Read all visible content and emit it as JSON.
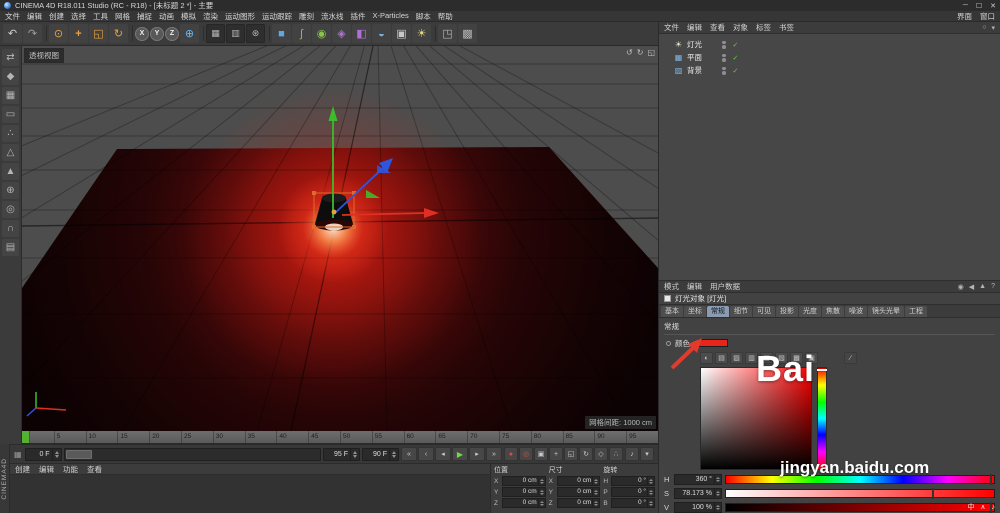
{
  "icons": {
    "check": "✓",
    "film": "▦",
    "eyedropper": "∕"
  },
  "titlebar": {
    "title": "CINEMA 4D R18.011 Studio (RC - R18) - [未标题 2 *] - 主要",
    "minimize": "─",
    "maximize": "☐",
    "close": "✕"
  },
  "menubar": {
    "items": [
      "文件",
      "编辑",
      "创建",
      "选择",
      "工具",
      "网格",
      "捕捉",
      "动画",
      "模拟",
      "渲染",
      "运动图形",
      "运动跟踪",
      "雕刻",
      "流水线",
      "插件",
      "X-Particles",
      "脚本",
      "帮助"
    ],
    "right_items": [
      "界面",
      "窗口"
    ]
  },
  "toolbar": {
    "icons": [
      {
        "name": "undo-icon",
        "glyph": "↶",
        "color": "#cfcfcf"
      },
      {
        "name": "redo-icon",
        "glyph": "↷",
        "color": "#9f9f9f"
      },
      {
        "name": "toolbar-separator",
        "cls": "sep",
        "glyph": "",
        "inter": false
      },
      {
        "name": "live-selection-icon",
        "glyph": "⊙",
        "color": "#e8a33d"
      },
      {
        "name": "move-tool-icon",
        "glyph": "+",
        "color": "#e8a33d",
        "cls": "bold"
      },
      {
        "name": "scale-tool-icon",
        "glyph": "◱",
        "color": "#e8a33d"
      },
      {
        "name": "rotate-tool-icon",
        "glyph": "↻",
        "color": "#e8a33d"
      },
      {
        "name": "toolbar-separator",
        "cls": "sep",
        "glyph": "",
        "inter": false
      },
      {
        "name": "x-axis-lock-button",
        "glyph": "X",
        "cls": "axis"
      },
      {
        "name": "y-axis-lock-button",
        "glyph": "Y",
        "cls": "axis"
      },
      {
        "name": "z-axis-lock-button",
        "glyph": "Z",
        "cls": "axis"
      },
      {
        "name": "coordinate-system-icon",
        "glyph": "⊕",
        "color": "#6fb3e8"
      },
      {
        "name": "toolbar-separator",
        "cls": "sep",
        "glyph": "",
        "inter": false
      },
      {
        "name": "render-view-icon",
        "glyph": "▦",
        "cls": "dark",
        "color": "#b5b5b5"
      },
      {
        "name": "render-picture-viewer-icon",
        "glyph": "▥",
        "cls": "dark",
        "color": "#b5b5b5"
      },
      {
        "name": "render-settings-icon",
        "glyph": "⊛",
        "cls": "dark",
        "color": "#b5b5b5"
      },
      {
        "name": "toolbar-separator",
        "cls": "sep",
        "glyph": "",
        "inter": false
      },
      {
        "name": "add-primitive-icon",
        "glyph": "■",
        "color": "#5fa8e0"
      },
      {
        "name": "add-spline-icon",
        "glyph": "∫",
        "color": "#8ac34a"
      },
      {
        "name": "add-generator-icon",
        "glyph": "◉",
        "color": "#8ac34a"
      },
      {
        "name": "add-mograph-icon",
        "glyph": "◈",
        "color": "#b06fd8"
      },
      {
        "name": "add-deformer-icon",
        "glyph": "◧",
        "color": "#b06fd8"
      },
      {
        "name": "add-environment-icon",
        "glyph": "◒",
        "color": "#6fb3e8"
      },
      {
        "name": "add-camera-icon",
        "glyph": "▣",
        "color": "#c8c8c8"
      },
      {
        "name": "add-light-icon",
        "glyph": "☀",
        "color": "#e8d87a"
      },
      {
        "name": "toolbar-separator",
        "cls": "sep",
        "glyph": "",
        "inter": false
      },
      {
        "name": "display-mode-icon",
        "glyph": "◳",
        "color": "#b5b5b5"
      },
      {
        "name": "view-panel-icon",
        "glyph": "▩",
        "color": "#b5b5b5"
      }
    ]
  },
  "left_toolbar": {
    "brand": "CINEMA4D",
    "icons": [
      {
        "name": "make-editable-icon",
        "glyph": "⇄"
      },
      {
        "name": "model-mode-icon",
        "glyph": "◆"
      },
      {
        "name": "texture-mode-icon",
        "glyph": "▦"
      },
      {
        "name": "workplane-mode-icon",
        "glyph": "▭"
      },
      {
        "name": "points-mode-icon",
        "glyph": "∴"
      },
      {
        "name": "edges-mode-icon",
        "glyph": "△"
      },
      {
        "name": "polygons-mode-icon",
        "glyph": "▲"
      },
      {
        "name": "enable-axis-icon",
        "glyph": "⊕"
      },
      {
        "name": "viewport-solo-icon",
        "glyph": "◎"
      },
      {
        "name": "snap-icon",
        "glyph": "∩"
      },
      {
        "name": "workplane-lock-icon",
        "glyph": "▤"
      }
    ]
  },
  "viewport": {
    "label": "透视视图",
    "grid_info": "网格间距: 1000 cm",
    "corner_icons": [
      {
        "name": "undo-view-icon",
        "glyph": "↺"
      },
      {
        "name": "redo-view-icon",
        "glyph": "↻"
      },
      {
        "name": "toggle-views-icon",
        "glyph": "◱"
      }
    ]
  },
  "ruler": {
    "ticks": [
      "0",
      "5",
      "10",
      "15",
      "20",
      "25",
      "30",
      "35",
      "40",
      "45",
      "50",
      "55",
      "60",
      "65",
      "70",
      "75",
      "80",
      "85",
      "90",
      "95"
    ]
  },
  "transport": {
    "current": "0 F",
    "end": "95 F",
    "loop": "90 F",
    "buttons": [
      {
        "name": "goto-start-button",
        "glyph": "«"
      },
      {
        "name": "prev-key-button",
        "glyph": "‹"
      },
      {
        "name": "prev-frame-button",
        "glyph": "◂"
      },
      {
        "name": "play-button",
        "glyph": "▶",
        "cls": "play"
      },
      {
        "name": "next-frame-button",
        "glyph": "▸"
      },
      {
        "name": "goto-end-button",
        "glyph": "»"
      }
    ],
    "record_buttons": [
      {
        "name": "record-keyframe-button",
        "glyph": "●",
        "cls": "red"
      },
      {
        "name": "autokey-button",
        "glyph": "◎",
        "cls": "red"
      },
      {
        "name": "keyframe-selection-button",
        "glyph": "▣"
      },
      {
        "name": "record-position-button",
        "glyph": "+"
      },
      {
        "name": "record-scale-button",
        "glyph": "◱"
      },
      {
        "name": "record-rotation-button",
        "glyph": "↻"
      },
      {
        "name": "record-parameter-button",
        "glyph": "◇"
      },
      {
        "name": "record-pla-button",
        "glyph": "∴"
      }
    ],
    "end_buttons": [
      {
        "name": "sound-toggle-button",
        "glyph": "♪"
      },
      {
        "name": "playback-options-button",
        "glyph": "▾"
      }
    ]
  },
  "material_manager": {
    "menus": [
      "创建",
      "编辑",
      "功能",
      "查看"
    ]
  },
  "coordinates": {
    "groups": [
      {
        "title": "位置",
        "rows": [
          {
            "label": "X",
            "value": "0 cm"
          },
          {
            "label": "Y",
            "value": "0 cm"
          },
          {
            "label": "Z",
            "value": "0 cm"
          }
        ]
      },
      {
        "title": "尺寸",
        "rows": [
          {
            "label": "X",
            "value": "0 cm"
          },
          {
            "label": "Y",
            "value": "0 cm"
          },
          {
            "label": "Z",
            "value": "0 cm"
          }
        ]
      },
      {
        "title": "旋转",
        "rows": [
          {
            "label": "H",
            "value": "0 °"
          },
          {
            "label": "P",
            "value": "0 °"
          },
          {
            "label": "B",
            "value": "0 °"
          }
        ]
      }
    ]
  },
  "object_manager": {
    "menus": [
      "文件",
      "编辑",
      "查看",
      "对象",
      "标签",
      "书签"
    ],
    "right_icons": [
      {
        "name": "om-search-icon",
        "glyph": "○"
      },
      {
        "name": "om-filter-icon",
        "glyph": "▾"
      }
    ],
    "objects": [
      {
        "label": "灯光",
        "glyph": "☀",
        "icon_style": "color:#f2ecd8"
      },
      {
        "label": "平面",
        "glyph": "▦",
        "icon_style": "color:#7db7e8"
      },
      {
        "label": "背景",
        "glyph": "▨",
        "icon_style": "color:#7db7e8"
      }
    ]
  },
  "attribute_manager": {
    "menus": [
      "模式",
      "编辑",
      "用户数据"
    ],
    "right_icons": [
      {
        "name": "am-lock-icon",
        "glyph": "◉"
      },
      {
        "name": "am-back-icon",
        "glyph": "◀"
      },
      {
        "name": "am-forward-icon",
        "glyph": "▲"
      },
      {
        "name": "am-help-icon",
        "glyph": "?"
      }
    ],
    "object_title": "灯光对象 [灯光]",
    "tabs": [
      {
        "label": "基本"
      },
      {
        "label": "坐标"
      },
      {
        "label": "常规",
        "cls": "active"
      },
      {
        "label": "细节"
      },
      {
        "label": "可见"
      },
      {
        "label": "投影"
      },
      {
        "label": "光度"
      },
      {
        "label": "焦散"
      },
      {
        "label": "噪波"
      },
      {
        "label": "镜头光晕"
      },
      {
        "label": "工程"
      }
    ],
    "section": "常规",
    "color_label": "颜色",
    "swatch_style": "background:#e8251a",
    "picker_icons": [
      {
        "name": "color-wheel-icon",
        "glyph": "◐"
      },
      {
        "name": "color-spectrum-icon",
        "glyph": "▤"
      },
      {
        "name": "color-from-image-icon",
        "glyph": "▨"
      },
      {
        "name": "color-rgb-icon",
        "glyph": "▥"
      },
      {
        "name": "color-hsv-icon",
        "glyph": "▦"
      },
      {
        "name": "color-kelvin-icon",
        "glyph": "▧"
      },
      {
        "name": "color-mixer-icon",
        "glyph": "▩"
      },
      {
        "name": "color-swatches-icon",
        "glyph": "▣"
      }
    ],
    "grad_marker_style": "left:76%;top:2px",
    "hue_marker_style": "top:1px",
    "hsv": {
      "h": {
        "label": "H",
        "value": "360 °",
        "marker_style": "left:98.5%"
      },
      "s": {
        "label": "S",
        "value": "78.173 %",
        "marker_style": "left:77%"
      },
      "v": {
        "label": "V",
        "value": "100 %",
        "marker_style": "left:98.5%"
      }
    }
  },
  "watermark": {
    "big": "Bai",
    "small": "jingyan.baidu.com"
  },
  "tray": {
    "text": "中 ∧ ♪"
  },
  "colors": {
    "accent_red": "#e8251a",
    "gizmo_x": "#dd2f22",
    "gizmo_y": "#3dbb2e",
    "gizmo_z": "#2f55dd",
    "playhead_green": "#53b22f"
  }
}
